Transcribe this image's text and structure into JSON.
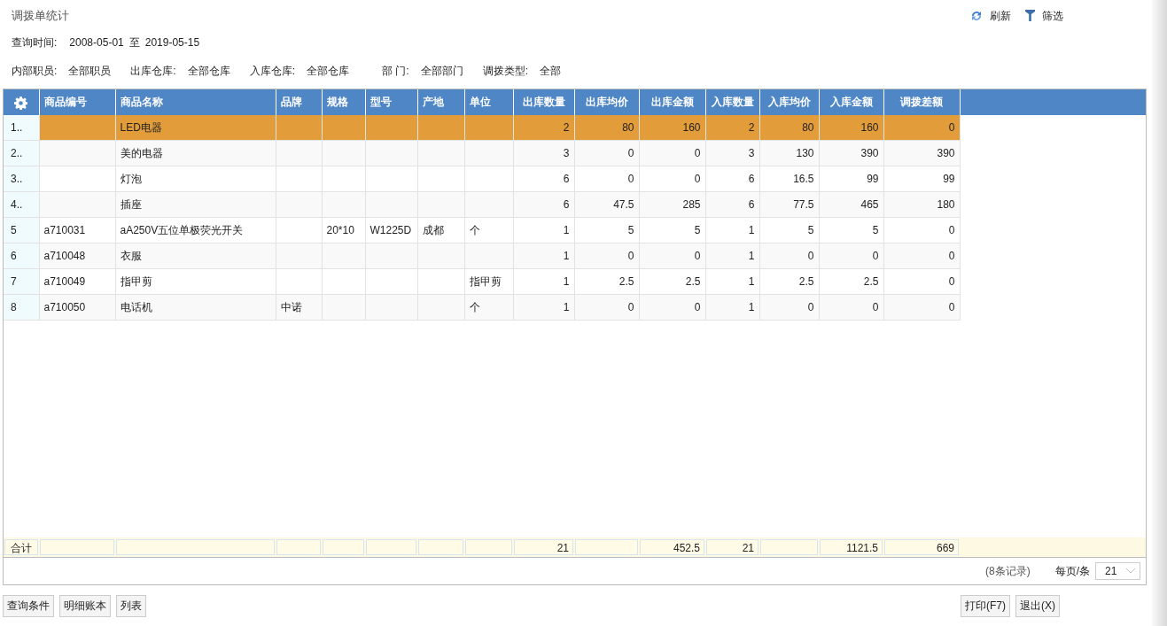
{
  "title": "调拨单统计",
  "toolbar": [
    {
      "kind": "refresh",
      "label": "刷新"
    },
    {
      "kind": "filter",
      "label": "筛选"
    }
  ],
  "query_time": {
    "label": "查询时间:",
    "from": "2008-05-01",
    "separator": "至",
    "to": "2019-05-15"
  },
  "filters": [
    {
      "label": "内部职员:",
      "value": "全部职员"
    },
    {
      "label": "出库仓库:",
      "value": "全部仓库"
    },
    {
      "label": "入库仓库:",
      "value": "全部仓库"
    },
    {
      "label": "部 门:",
      "value": "全部部门"
    },
    {
      "label": "调拨类型:",
      "value": "全部"
    }
  ],
  "table": {
    "columns": [
      "",
      "商品编号",
      "商品名称",
      "品牌",
      "规格",
      "型号",
      "产地",
      "单位",
      "出库数量",
      "出库均价",
      "出库金额",
      "入库数量",
      "入库均价",
      "入库金额",
      "调拨差额"
    ],
    "rows": [
      {
        "selected": true,
        "cells": [
          "1..",
          "",
          "LED电器",
          "",
          "",
          "",
          "",
          "",
          "2",
          "80",
          "160",
          "2",
          "80",
          "160",
          "0"
        ]
      },
      {
        "selected": false,
        "cells": [
          "2..",
          "",
          "美的电器",
          "",
          "",
          "",
          "",
          "",
          "3",
          "0",
          "0",
          "3",
          "130",
          "390",
          "390"
        ]
      },
      {
        "selected": false,
        "cells": [
          "3..",
          "",
          "灯泡",
          "",
          "",
          "",
          "",
          "",
          "6",
          "0",
          "0",
          "6",
          "16.5",
          "99",
          "99"
        ]
      },
      {
        "selected": false,
        "cells": [
          "4..",
          "",
          "插座",
          "",
          "",
          "",
          "",
          "",
          "6",
          "47.5",
          "285",
          "6",
          "77.5",
          "465",
          "180"
        ]
      },
      {
        "selected": false,
        "cells": [
          "5",
          "a710031",
          "aA250V五位单极荧光开关",
          "",
          "20*10",
          "W1225D",
          "成都",
          "个",
          "1",
          "5",
          "5",
          "1",
          "5",
          "5",
          "0"
        ]
      },
      {
        "selected": false,
        "cells": [
          "6",
          "a710048",
          "衣服",
          "",
          "",
          "",
          "",
          "",
          "1",
          "0",
          "0",
          "1",
          "0",
          "0",
          "0"
        ]
      },
      {
        "selected": false,
        "cells": [
          "7",
          "a710049",
          "指甲剪",
          "",
          "",
          "",
          "",
          "指甲剪",
          "1",
          "2.5",
          "2.5",
          "1",
          "2.5",
          "2.5",
          "0"
        ]
      },
      {
        "selected": false,
        "cells": [
          "8",
          "a710050",
          "电话机",
          "中诺",
          "",
          "",
          "",
          "个",
          "1",
          "0",
          "0",
          "1",
          "0",
          "0",
          "0"
        ]
      }
    ],
    "totals": {
      "label": "合计",
      "out_qty": "21",
      "out_amount": "452.5",
      "in_qty": "21",
      "in_amount": "1121.5",
      "difference": "669"
    }
  },
  "pager": {
    "records": "(8条记录)",
    "per_page_label": "每页/条",
    "per_page": "21"
  },
  "buttons_left": [
    "查询条件",
    "明细账本",
    "列表"
  ],
  "buttons_right": [
    "打印(F7)",
    "退出(X)"
  ]
}
